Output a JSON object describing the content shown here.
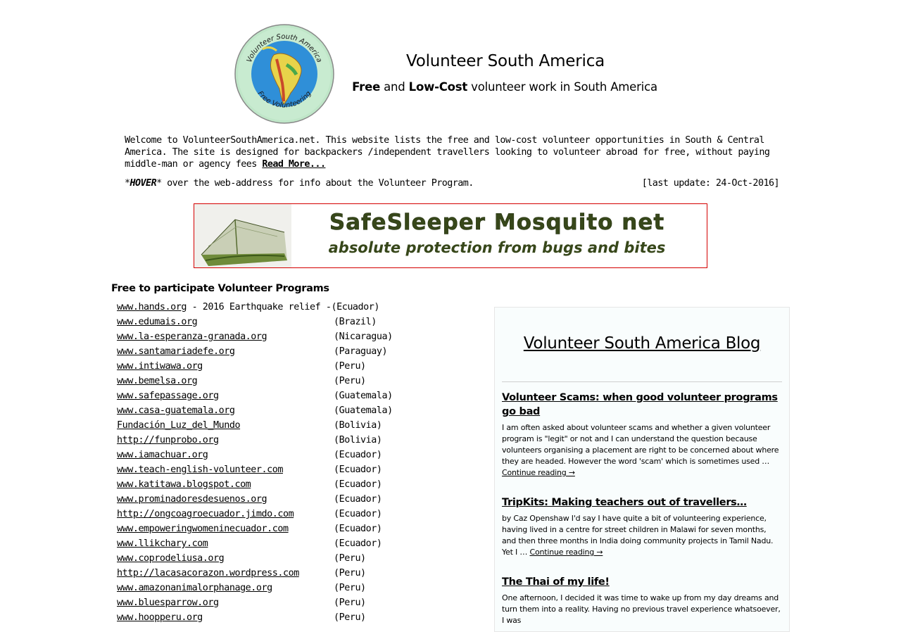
{
  "header": {
    "logo_text_top": "Volunteer South America",
    "logo_text_bottom": "Free Volunteering",
    "site_title": "Volunteer South America",
    "tagline_free": "Free",
    "tagline_and": " and ",
    "tagline_lowcost": "Low-Cost",
    "tagline_rest": " volunteer work in South America"
  },
  "intro": {
    "text": "Welcome to VolunteerSouthAmerica.net. This website lists the free and low-cost volunteer opportunities in South & Central America. The site is designed for backpackers /independent travellers looking to volunteer abroad for free, without paying middle-man or agency fees ",
    "read_more": "Read More..."
  },
  "hover_note": {
    "prefix": "*",
    "hover": "HOVER",
    "suffix": "* over the web-address for info about the Volunteer Program.",
    "last_update": "[last update: 24-Oct-2016]"
  },
  "ad": {
    "title": "SafeSleeper Mosquito net",
    "subtitle": "absolute protection from bugs and bites"
  },
  "programs": {
    "heading": "Free to participate Volunteer Programs",
    "first_link": "www.hands.org",
    "first_text": " - 2016 Earthquake relief -(Ecuador)",
    "items": [
      {
        "link": "www.edumais.org",
        "country": "(Brazil)"
      },
      {
        "link": "www.la-esperanza-granada.org",
        "country": "(Nicaragua)"
      },
      {
        "link": "www.santamariadefe.org",
        "country": "(Paraguay)"
      },
      {
        "link": "www.intiwawa.org",
        "country": "(Peru)"
      },
      {
        "link": "www.bemelsa.org",
        "country": "(Peru)"
      },
      {
        "link": "www.safepassage.org",
        "country": "(Guatemala)"
      },
      {
        "link": "www.casa-guatemala.org",
        "country": "(Guatemala)"
      },
      {
        "link": "Fundación_Luz_del_Mundo",
        "country": "(Bolivia)"
      },
      {
        "link": "http://funprobo.org",
        "country": "(Bolivia)"
      },
      {
        "link": "www.iamachuar.org",
        "country": "(Ecuador)"
      },
      {
        "link": "www.teach-english-volunteer.com",
        "country": "(Ecuador)"
      },
      {
        "link": "www.katitawa.blogspot.com",
        "country": "(Ecuador)"
      },
      {
        "link": "www.prominadoresdesuenos.org",
        "country": "(Ecuador)"
      },
      {
        "link": "http://ongcoagroecuador.jimdo.com",
        "country": "(Ecuador)"
      },
      {
        "link": "www.empoweringwomeninecuador.com",
        "country": "(Ecuador)"
      },
      {
        "link": "www.llikchary.com",
        "country": "(Ecuador)"
      },
      {
        "link": "www.coprodeliusa.org",
        "country": "(Peru)"
      },
      {
        "link": "http://lacasacorazon.wordpress.com",
        "country": "(Peru)"
      },
      {
        "link": "www.amazonanimalorphanage.org",
        "country": "(Peru)"
      },
      {
        "link": "www.bluesparrow.org",
        "country": "(Peru)"
      },
      {
        "link": "www.hoopperu.org",
        "country": "(Peru)"
      }
    ]
  },
  "blog": {
    "title": "Volunteer South America Blog",
    "posts": [
      {
        "title": "Volunteer Scams: when good volunteer programs go bad",
        "excerpt": "I am often asked about volunteer scams and whether a given volunteer program is \"legit\" or not and I can understand the question because volunteers organising a placement are right to be concerned about where they are headed. However the word 'scam' which is sometimes used … ",
        "more": "Continue reading →"
      },
      {
        "title": "TripKits: Making teachers out of travellers…",
        "excerpt": "by Caz Openshaw I'd say I have quite a bit of volunteering experience, having lived in a centre for street children in Malawi for seven months, and then three months in India doing community projects in Tamil Nadu. Yet I … ",
        "more": "Continue reading →"
      },
      {
        "title": "The Thai of my life!",
        "excerpt": "One afternoon, I decided it was time to wake up from my day dreams and turn them into a reality. Having no previous travel experience whatsoever, I was",
        "more": ""
      }
    ]
  },
  "colors": {
    "ad_border": "#d40000",
    "ad_text": "#37471a",
    "blog_bg": "#f9fdfd"
  }
}
